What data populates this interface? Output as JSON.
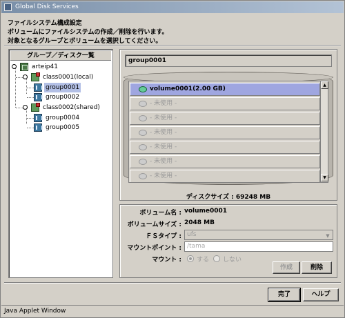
{
  "window": {
    "title": "Global Disk Services"
  },
  "header": {
    "line1": "ファイルシステム構成設定",
    "line2": "ボリュームにファイルシステムの作成／削除を行います。",
    "line3": "対象となるグループとボリュームを選択してください。"
  },
  "tree": {
    "header": "グループ／ディスク一覧",
    "host": "arteip41",
    "classes": [
      {
        "label": "class0001(local)",
        "groups": [
          "group0001",
          "group0002"
        ]
      },
      {
        "label": "class0002(shared)",
        "groups": [
          "group0004",
          "group0005"
        ]
      }
    ],
    "selected_group": "group0001"
  },
  "group_panel": {
    "group_name": "group0001",
    "volumes": [
      {
        "label": "volume0001(2.00 GB)",
        "selected": true
      },
      {
        "label": "- 未使用 -",
        "selected": false
      },
      {
        "label": "- 未使用 -",
        "selected": false
      },
      {
        "label": "- 未使用 -",
        "selected": false
      },
      {
        "label": "- 未使用 -",
        "selected": false
      },
      {
        "label": "- 未使用 -",
        "selected": false
      },
      {
        "label": "- 未使用 -",
        "selected": false
      }
    ],
    "disk_size": "ディスクサイズ : 69248 MB"
  },
  "details": {
    "volume_name_label": "ボリューム名 :",
    "volume_name_value": "volume0001",
    "volume_size_label": "ボリュームサイズ :",
    "volume_size_value": "2048 MB",
    "fs_type_label": "ＦＳタイプ :",
    "fs_type_value": "ufs",
    "mount_point_label": "マウントポイント :",
    "mount_point_value": "/tama",
    "mount_label": "マウント :",
    "mount_options": [
      {
        "label": "する",
        "checked": true
      },
      {
        "label": "しない",
        "checked": false
      }
    ],
    "create_button": "作成",
    "delete_button": "削除"
  },
  "footer": {
    "done_button": "完了",
    "help_button": "ヘルプ"
  },
  "status": {
    "text": "Java Applet Window"
  },
  "colors": {
    "selection": "#9fa6e0",
    "tree_selection": "#b3c0e6",
    "title_bar": "#7a8fa8"
  }
}
